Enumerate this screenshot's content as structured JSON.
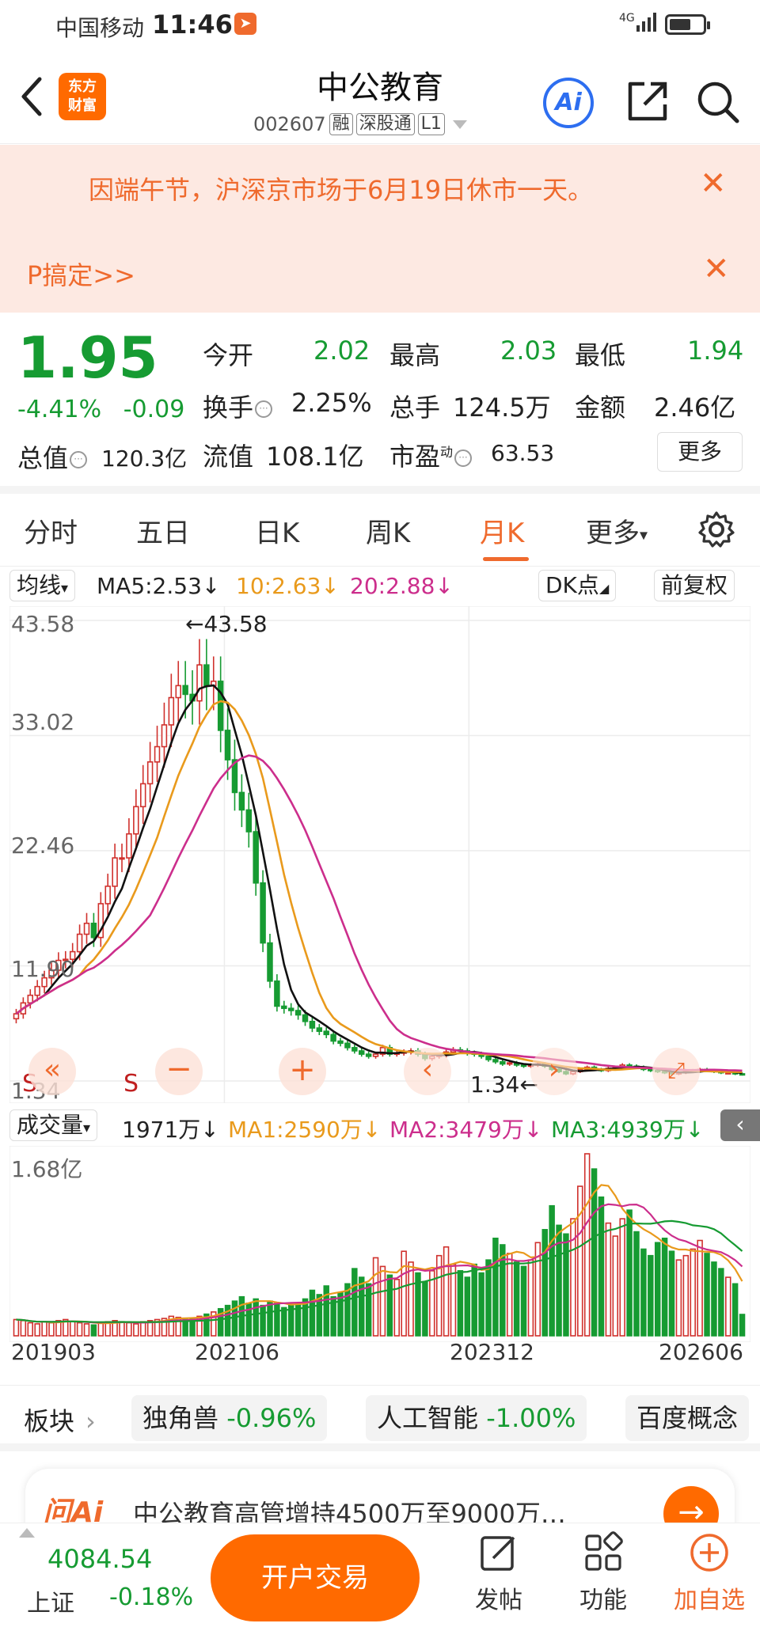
{
  "status_bar": {
    "carrier": "中国移动",
    "time": "11:46",
    "network": "4G"
  },
  "header": {
    "logo_line1": "东方",
    "logo_line2": "财富",
    "title": "中公教育",
    "code": "002607",
    "tags": [
      "融",
      "深股通",
      "L1"
    ],
    "ai_label": "Ai"
  },
  "notice": {
    "line1": "因端午节，沪深京市场于6月19日休市一天。",
    "line2": "P搞定>>",
    "close": "✕"
  },
  "quote": {
    "price": "1.95",
    "change_pct": "-4.41%",
    "change": "-0.09",
    "open_label": "今开",
    "open": "2.02",
    "high_label": "最高",
    "high": "2.03",
    "low_label": "最低",
    "low": "1.94",
    "turnover_label": "换手",
    "turnover": "2.25%",
    "volume_label": "总手",
    "volume": "124.5万",
    "amount_label": "金额",
    "amount": "2.46亿",
    "mcap_label": "总值",
    "mcap": "120.3亿",
    "float_label": "流值",
    "float": "108.1亿",
    "pe_label": "市盈",
    "pe_sup": "动",
    "pe": "63.53",
    "more": "更多"
  },
  "tabs": {
    "items": [
      "分时",
      "五日",
      "日K",
      "周K",
      "月K",
      "更多"
    ],
    "active": "月K"
  },
  "ma_row": {
    "chip": "均线",
    "ma5": "MA5:2.53",
    "ma10": "10:2.63",
    "ma20": "20:2.88",
    "arrow": "↓",
    "dk": "DK点",
    "adjust": "前复权"
  },
  "kchart": {
    "y_labels": [
      "43.58",
      "33.02",
      "22.46",
      "11.90",
      "1.34"
    ],
    "max_label": "←43.58",
    "min_label": "1.34←",
    "s1": "S",
    "s2": "S"
  },
  "vol_row": {
    "chip": "成交量",
    "vol": "1971万",
    "ma1": "MA1:2590万",
    "ma2": "MA2:3479万",
    "ma3": "MA3:4939万",
    "arrow": "↓",
    "y_label": "1.68亿"
  },
  "x_labels": [
    "201903",
    "202106",
    "202312",
    "202606"
  ],
  "sector": {
    "label": "板块",
    "chips": [
      {
        "name": "独角兽",
        "chg": "-0.96%"
      },
      {
        "name": "人工智能",
        "chg": "-1.00%"
      },
      {
        "name": "百度概念",
        "chg": ""
      }
    ]
  },
  "ai_card": {
    "logo": "问Ai",
    "text": "中公教育高管增持4500万至9000万…"
  },
  "bottom": {
    "index_value": "4084.54",
    "index_name": "上证",
    "index_chg": "-0.18%",
    "trade": "开户交易",
    "post": "发帖",
    "func": "功能",
    "watch": "加自选"
  },
  "colors": {
    "up": "#d0312d",
    "down": "#169b32",
    "accent": "#ef6a2d",
    "ma5": "#111111",
    "ma10": "#e99a1c",
    "ma20": "#cc2e8c"
  },
  "chart_data": {
    "type": "candlestick",
    "title": "",
    "frequency": "monthly",
    "x_ticks": [
      "201903",
      "202106",
      "202312",
      "202606"
    ],
    "ylim": [
      1.34,
      43.58
    ],
    "y_ticks": [
      43.58,
      33.02,
      22.46,
      11.9,
      1.34
    ],
    "series": [
      {
        "name": "MA5",
        "value": 2.53
      },
      {
        "name": "10",
        "value": 2.63
      },
      {
        "name": "20",
        "value": 2.88
      }
    ],
    "price_close_approx": [
      7.5,
      8.5,
      9.2,
      10.0,
      10.8,
      11.5,
      12.4,
      12.5,
      13.2,
      14.8,
      15.8,
      14.5,
      17.6,
      19.2,
      21.8,
      21.8,
      24.0,
      26.5,
      28.6,
      30.6,
      32.0,
      34.0,
      36.5,
      37.6,
      36.8,
      36.2,
      39.5,
      37.6,
      38.0,
      33.5,
      30.8,
      27.8,
      26.2,
      24.2,
      19.5,
      14.0,
      10.5,
      8.2,
      8.0,
      7.8,
      7.4,
      6.8,
      6.2,
      5.9,
      5.6,
      5.0,
      4.8,
      4.4,
      4.1,
      3.8,
      3.6,
      3.8,
      4.4,
      3.8,
      3.9,
      4.0,
      4.1,
      3.8,
      3.4,
      3.6,
      3.7,
      4.0,
      4.2,
      4.1,
      3.9,
      3.8,
      3.6,
      3.3,
      3.1,
      2.9,
      3.0,
      2.8,
      2.7,
      2.8,
      2.9,
      2.7,
      2.4,
      2.2,
      2.0,
      2.2,
      2.4,
      2.6,
      2.4,
      2.3,
      2.5,
      2.6,
      2.8,
      2.7,
      2.6,
      2.4,
      2.3,
      2.2,
      2.1,
      2.0,
      2.1,
      2.2,
      2.3,
      2.4,
      2.3,
      2.2,
      2.1,
      2.1,
      2.0,
      1.95
    ],
    "volume_approx_wan": [
      1500,
      1400,
      1200,
      1100,
      1300,
      1200,
      1400,
      1500,
      1300,
      1200,
      1100,
      1000,
      1200,
      1300,
      1400,
      1300,
      1200,
      1100,
      1300,
      1400,
      1500,
      1600,
      1800,
      1700,
      1500,
      1600,
      1800,
      2000,
      2200,
      2500,
      2800,
      3200,
      3600,
      3000,
      3400,
      2800,
      3200,
      3000,
      2600,
      2800,
      3000,
      3400,
      4200,
      3800,
      4600,
      3600,
      4000,
      4800,
      6200,
      5400,
      4800,
      7200,
      6400,
      5600,
      5200,
      7800,
      6800,
      5800,
      5000,
      6000,
      7400,
      8200,
      6600,
      6000,
      5400,
      6600,
      5800,
      7000,
      9000,
      8400,
      7600,
      6800,
      6400,
      7000,
      8600,
      9800,
      12000,
      10200,
      9400,
      10800,
      13800,
      16800,
      15400,
      12800,
      10400,
      9200,
      10800,
      11600,
      9600,
      8000,
      7400,
      8600,
      9000,
      7800,
      7000,
      7400,
      8000,
      8800,
      7600,
      6800,
      6200,
      5400,
      4800,
      1971
    ]
  }
}
